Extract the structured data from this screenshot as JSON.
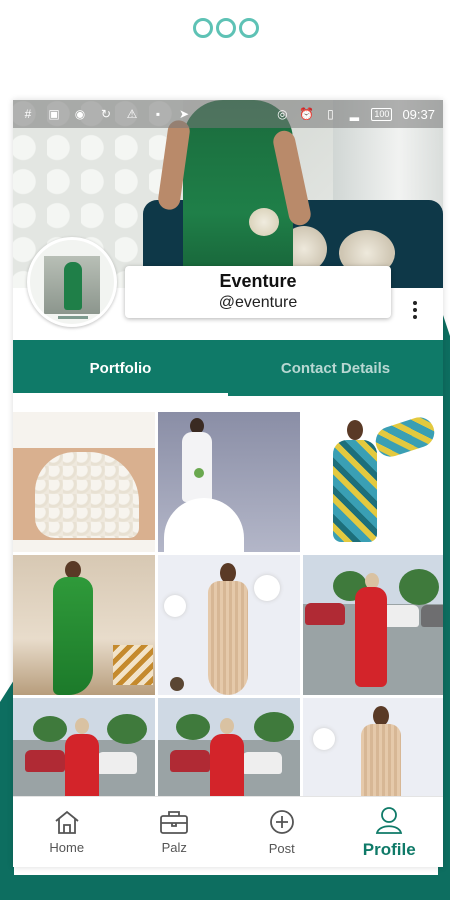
{
  "status_bar": {
    "time": "09:37",
    "battery": "100",
    "icons": [
      "hashtag-icon",
      "image-icon",
      "signal-broadcast-icon",
      "sync-icon",
      "warning-icon",
      "bag-icon",
      "send-icon",
      "hotspot-icon",
      "alarm-icon",
      "vibrate-icon",
      "signal-icon",
      "battery-icon"
    ]
  },
  "profile": {
    "name": "Eventure",
    "handle": "@eventure"
  },
  "tabs": [
    {
      "label": "Portfolio",
      "active": true
    },
    {
      "label": "Contact Details",
      "active": false
    }
  ],
  "gallery": {
    "tiles": [
      {
        "subject": "lace bodice detail"
      },
      {
        "subject": "white mermaid wedding gown"
      },
      {
        "subject": "teal and yellow print dress"
      },
      {
        "subject": "green sequin gown"
      },
      {
        "subject": "nude sequin gown with balloons"
      },
      {
        "subject": "red dress in parking lot"
      },
      {
        "subject": "red dress in parking lot"
      },
      {
        "subject": "red dress in parking lot"
      },
      {
        "subject": "nude sequin gown"
      }
    ]
  },
  "bottom_nav": [
    {
      "label": "Home",
      "icon": "home-icon",
      "active": false
    },
    {
      "label": "Palz",
      "icon": "briefcase-icon",
      "active": false
    },
    {
      "label": "Post",
      "icon": "plus-circle-icon",
      "active": false
    },
    {
      "label": "Profile",
      "icon": "user-icon",
      "active": true
    }
  ],
  "colors": {
    "primary": "#0f7a68",
    "logo": "#5ec2b5",
    "background_accent": "#0d6e60"
  }
}
